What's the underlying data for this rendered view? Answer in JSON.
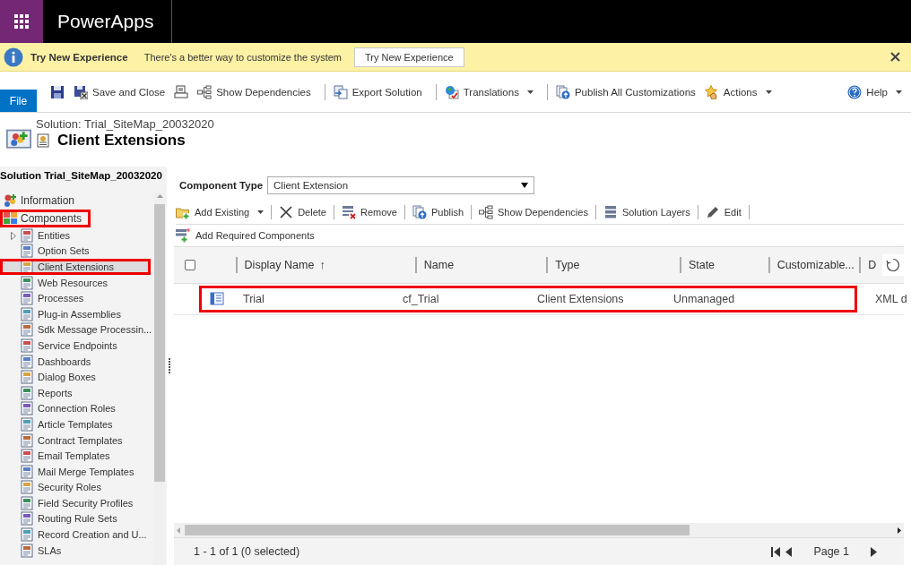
{
  "app_bar": {
    "title": "PowerApps"
  },
  "notification": {
    "title": "Try New Experience",
    "message": "There's a better way to customize the system",
    "button": "Try New Experience"
  },
  "ribbon": {
    "file_tab": "File",
    "commands": [
      {
        "kind": "save",
        "dropdown": false
      },
      {
        "kind": "save-close",
        "label": "Save and Close",
        "dropdown": false
      },
      {
        "kind": "print",
        "dropdown": false
      },
      {
        "kind": "dependencies",
        "label": "Show Dependencies",
        "dropdown": false
      },
      {
        "kind": "separator"
      },
      {
        "kind": "export",
        "label": "Export Solution",
        "dropdown": false
      },
      {
        "kind": "separator"
      },
      {
        "kind": "translations",
        "label": "Translations",
        "dropdown": true
      },
      {
        "kind": "separator"
      },
      {
        "kind": "publish",
        "label": "Publish All Customizations",
        "dropdown": false
      },
      {
        "kind": "actions",
        "label": "Actions",
        "dropdown": true
      }
    ],
    "help": {
      "label": "Help",
      "dropdown": true
    }
  },
  "header": {
    "solution": "Solution: Trial_SiteMap_20032020",
    "title": "Client Extensions"
  },
  "sidebar": {
    "title": "Solution Trial_SiteMap_20032020",
    "items": [
      {
        "label": "Information",
        "highlighted": false
      },
      {
        "label": "Components",
        "highlighted": true,
        "children": [
          {
            "label": "Entities",
            "expandable": true,
            "selected": false,
            "highlighted": false
          },
          {
            "label": "Option Sets",
            "expandable": false,
            "selected": false,
            "highlighted": false
          },
          {
            "label": "Client Extensions",
            "expandable": false,
            "selected": true,
            "highlighted": true
          },
          {
            "label": "Web Resources",
            "expandable": false,
            "selected": false,
            "highlighted": false
          },
          {
            "label": "Processes",
            "expandable": false,
            "selected": false,
            "highlighted": false
          },
          {
            "label": "Plug-in Assemblies",
            "expandable": false,
            "selected": false,
            "highlighted": false
          },
          {
            "label": "Sdk Message Processin...",
            "expandable": false,
            "selected": false,
            "highlighted": false
          },
          {
            "label": "Service Endpoints",
            "expandable": false,
            "selected": false,
            "highlighted": false
          },
          {
            "label": "Dashboards",
            "expandable": false,
            "selected": false,
            "highlighted": false
          },
          {
            "label": "Dialog Boxes",
            "expandable": false,
            "selected": false,
            "highlighted": false
          },
          {
            "label": "Reports",
            "expandable": false,
            "selected": false,
            "highlighted": false
          },
          {
            "label": "Connection Roles",
            "expandable": false,
            "selected": false,
            "highlighted": false
          },
          {
            "label": "Article Templates",
            "expandable": false,
            "selected": false,
            "highlighted": false
          },
          {
            "label": "Contract Templates",
            "expandable": false,
            "selected": false,
            "highlighted": false
          },
          {
            "label": "Email Templates",
            "expandable": false,
            "selected": false,
            "highlighted": false
          },
          {
            "label": "Mail Merge Templates",
            "expandable": false,
            "selected": false,
            "highlighted": false
          },
          {
            "label": "Security Roles",
            "expandable": false,
            "selected": false,
            "highlighted": false
          },
          {
            "label": "Field Security Profiles",
            "expandable": false,
            "selected": false,
            "highlighted": false
          },
          {
            "label": "Routing Rule Sets",
            "expandable": false,
            "selected": false,
            "highlighted": false
          },
          {
            "label": "Record Creation and U...",
            "expandable": false,
            "selected": false,
            "highlighted": false
          },
          {
            "label": "SLAs",
            "expandable": false,
            "selected": false,
            "highlighted": false
          }
        ]
      }
    ]
  },
  "component_type": {
    "label": "Component Type",
    "value": "Client Extension"
  },
  "grid_toolbar": [
    {
      "kind": "add-existing",
      "label": "Add Existing",
      "dropdown": true
    },
    {
      "kind": "separator"
    },
    {
      "kind": "delete",
      "label": "Delete",
      "dropdown": false
    },
    {
      "kind": "separator"
    },
    {
      "kind": "remove",
      "label": "Remove",
      "dropdown": false
    },
    {
      "kind": "separator"
    },
    {
      "kind": "publish",
      "label": "Publish",
      "dropdown": false
    },
    {
      "kind": "separator"
    },
    {
      "kind": "dependencies",
      "label": "Show Dependencies",
      "dropdown": false
    },
    {
      "kind": "separator"
    },
    {
      "kind": "layers",
      "label": "Solution Layers",
      "dropdown": false
    },
    {
      "kind": "separator"
    },
    {
      "kind": "edit",
      "label": "Edit",
      "dropdown": false
    },
    {
      "kind": "separator"
    }
  ],
  "add_required": {
    "label": "Add Required Components"
  },
  "table": {
    "select_all": {
      "checked": false
    },
    "columns": [
      {
        "label": "Display Name",
        "sort_mark": "↑"
      },
      {
        "label": "Name"
      },
      {
        "label": "Type"
      },
      {
        "label": "State"
      },
      {
        "label": "Customizable..."
      },
      {
        "label": "D"
      }
    ],
    "rows": [
      {
        "selected": false,
        "highlighted": true,
        "cells": [
          "Trial",
          "cf_Trial",
          "Client Extensions",
          "Unmanaged",
          "",
          "XML d"
        ]
      }
    ]
  },
  "footer": {
    "summary": "1 - 1 of 1 (0 selected)",
    "page": "Page 1"
  }
}
